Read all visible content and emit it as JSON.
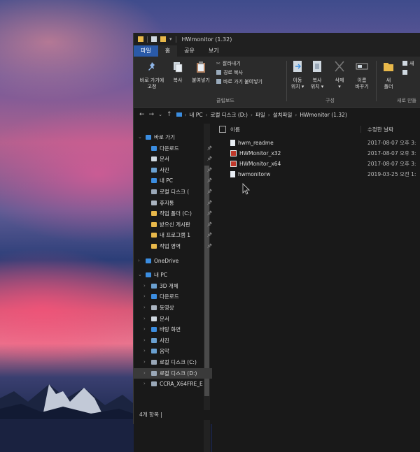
{
  "window": {
    "title": "HWmonitor (1.32)"
  },
  "tabs": [
    {
      "label": "파일"
    },
    {
      "label": "홈"
    },
    {
      "label": "공유"
    },
    {
      "label": "보기"
    }
  ],
  "ribbon": {
    "pin_label": "바로 가기에\n고정",
    "copy_label": "복사",
    "paste_label": "붙여넣기",
    "cut_label": "잘라내기",
    "copy_path_label": "경로 복사",
    "paste_shortcut_label": "바로 가기 붙여넣기",
    "clipboard_group": "클립보드",
    "move_to_label": "이동\n위치 ▾",
    "copy_to_label": "복사\n위치 ▾",
    "delete_label": "삭제\n▾",
    "rename_label": "이름\n바꾸기",
    "organize_group": "구성",
    "new_folder_label": "새\n폴더",
    "new_item_label": "새",
    "new_group": "새로 만들"
  },
  "address": {
    "crumbs": [
      "내 PC",
      "로컬 디스크 (D:)",
      "파일",
      "설치파일",
      "HWmonitor (1.32)"
    ]
  },
  "nav": {
    "items": [
      {
        "label": "바로 가기",
        "icon": "star-icon",
        "level": 0,
        "chev": "⌄",
        "color": "#3b8de0"
      },
      {
        "label": "다운로드",
        "icon": "download-icon",
        "level": 1,
        "pin": true,
        "color": "#3b8de0"
      },
      {
        "label": "문서",
        "icon": "document-icon",
        "level": 1,
        "pin": true,
        "color": "#cfd8e0"
      },
      {
        "label": "사진",
        "icon": "picture-icon",
        "level": 1,
        "pin": true,
        "color": "#6aa0d0"
      },
      {
        "label": "내 PC",
        "icon": "pc-icon",
        "level": 1,
        "pin": true,
        "color": "#3b8de0"
      },
      {
        "label": "로컬 디스크 (",
        "icon": "drive-icon",
        "level": 1,
        "pin": true,
        "color": "#9aa8b8"
      },
      {
        "label": "휴지통",
        "icon": "recycle-bin-icon",
        "level": 1,
        "pin": true,
        "color": "#aab4c0"
      },
      {
        "label": "작업 폴더 (C:)",
        "icon": "folder-icon",
        "level": 1,
        "pin": true,
        "color": "#e8b84a"
      },
      {
        "label": "받으신 게시판",
        "icon": "folder-icon",
        "level": 1,
        "pin": true,
        "color": "#e8b84a"
      },
      {
        "label": "내 프로그램 1",
        "icon": "folder-icon",
        "level": 1,
        "pin": true,
        "color": "#e8b84a"
      },
      {
        "label": "작업 영역",
        "icon": "folder-icon",
        "level": 1,
        "pin": true,
        "color": "#e8b84a"
      },
      {
        "label": "OneDrive",
        "icon": "cloud-icon",
        "level": 0,
        "chev": "›",
        "color": "#3b8de0",
        "gap": true
      },
      {
        "label": "내 PC",
        "icon": "pc-icon",
        "level": 0,
        "chev": "⌄",
        "color": "#3b8de0",
        "gap": true
      },
      {
        "label": "3D 개체",
        "icon": "cube-icon",
        "level": 1,
        "chev": "›",
        "color": "#6aa0d0"
      },
      {
        "label": "다운로드",
        "icon": "download-icon",
        "level": 1,
        "chev": "›",
        "color": "#3b8de0"
      },
      {
        "label": "동영상",
        "icon": "video-icon",
        "level": 1,
        "chev": "›",
        "color": "#aab4c0"
      },
      {
        "label": "문서",
        "icon": "document-icon",
        "level": 1,
        "chev": "›",
        "color": "#cfd8e0"
      },
      {
        "label": "바탕 화면",
        "icon": "desktop-icon",
        "level": 1,
        "chev": "›",
        "color": "#3b8de0"
      },
      {
        "label": "사진",
        "icon": "picture-icon",
        "level": 1,
        "chev": "›",
        "color": "#6aa0d0"
      },
      {
        "label": "음악",
        "icon": "music-icon",
        "level": 1,
        "chev": "›",
        "color": "#6aa0d0"
      },
      {
        "label": "로컬 디스크 (C:)",
        "icon": "drive-icon",
        "level": 1,
        "chev": "›",
        "color": "#9aa8b8"
      },
      {
        "label": "로컬 디스크 (D:)",
        "icon": "drive-icon",
        "level": 1,
        "chev": "›",
        "color": "#9aa8b8",
        "selected": true
      },
      {
        "label": "CCRA_X64FRE_E",
        "icon": "drive-icon",
        "level": 1,
        "chev": "›",
        "color": "#9aa8b8"
      }
    ]
  },
  "columns": {
    "name": "이름",
    "date": "수정한 날짜"
  },
  "files": [
    {
      "name": "hwm_readme",
      "date": "2017-08-07 오후 3:",
      "icon": "text-file-icon"
    },
    {
      "name": "HWMonitor_x32",
      "date": "2017-08-07 오후 3:",
      "icon": "app-icon"
    },
    {
      "name": "HWMonitor_x64",
      "date": "2017-08-07 오후 3:",
      "icon": "app-icon"
    },
    {
      "name": "hwmonitorw",
      "date": "2019-03-25 오전 1:",
      "icon": "config-file-icon"
    }
  ],
  "status": {
    "items": "4개 항목 |"
  }
}
